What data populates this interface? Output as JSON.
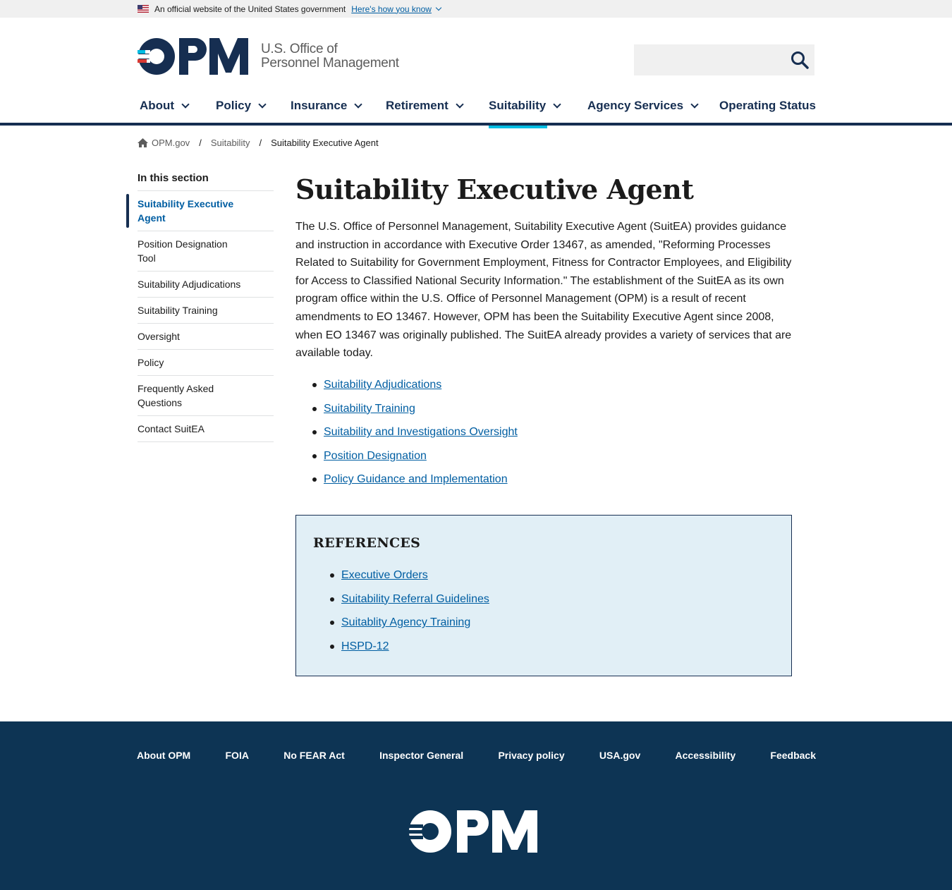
{
  "gov_banner": {
    "text": "An official website of the United States government",
    "link": "Here's how you know"
  },
  "header": {
    "logo_text_line1": "U.S. Office of",
    "logo_text_line2": "Personnel Management",
    "search_placeholder": ""
  },
  "nav": {
    "items": [
      {
        "label": "About",
        "dropdown": true
      },
      {
        "label": "Policy",
        "dropdown": true
      },
      {
        "label": "Insurance",
        "dropdown": true
      },
      {
        "label": "Retirement",
        "dropdown": true
      },
      {
        "label": "Suitability",
        "dropdown": true,
        "active": true
      },
      {
        "label": "Agency Services",
        "dropdown": true
      },
      {
        "label": "Operating Status",
        "dropdown": false
      }
    ]
  },
  "breadcrumb": {
    "home": "OPM.gov",
    "section": "Suitability",
    "current": "Suitability Executive Agent",
    "separator": "/"
  },
  "sidenav": {
    "title": "In this section",
    "items": [
      "Suitability Executive Agent",
      "Position Designation Tool",
      "Suitability Adjudications",
      "Suitability Training",
      "Oversight",
      "Policy",
      "Frequently Asked Questions",
      "Contact SuitEA"
    ]
  },
  "main": {
    "title": "Suitability Executive Agent",
    "intro": "The U.S. Office of Personnel Management, Suitability Executive Agent (SuitEA) provides guidance and instruction in accordance with Executive Order 13467, as amended, \"Reforming Processes Related to Suitability for Government Employment, Fitness for Contractor Employees, and Eligibility for Access to Classified National Security Information.\" The establishment of the SuitEA as its own program office within the U.S. Office of Personnel Management (OPM) is a result of recent amendments to EO 13467. However, OPM has been the Suitability Executive Agent since 2008, when EO 13467 was originally published. The SuitEA already provides a variety of services that are available today.",
    "links": [
      "Suitability Adjudications",
      "Suitability Training",
      "Suitability and Investigations Oversight",
      "Position Designation",
      "Policy Guidance and Implementation"
    ]
  },
  "references": {
    "title": "REFERENCES",
    "links": [
      "Executive Orders",
      "Suitability Referral Guidelines",
      "Suitablity Agency Training",
      "HSPD-12"
    ]
  },
  "footer": {
    "links": [
      "About OPM",
      "FOIA",
      "No FEAR Act",
      "Inspector General",
      "Privacy policy",
      "USA.gov",
      "Accessibility",
      "Feedback"
    ]
  },
  "colors": {
    "navy": "#162e51",
    "link": "#005ea2",
    "accent": "#00bde3",
    "footer_bg": "#0d3454",
    "refs_bg": "#e1eff6",
    "logo_red": "#d83933"
  }
}
